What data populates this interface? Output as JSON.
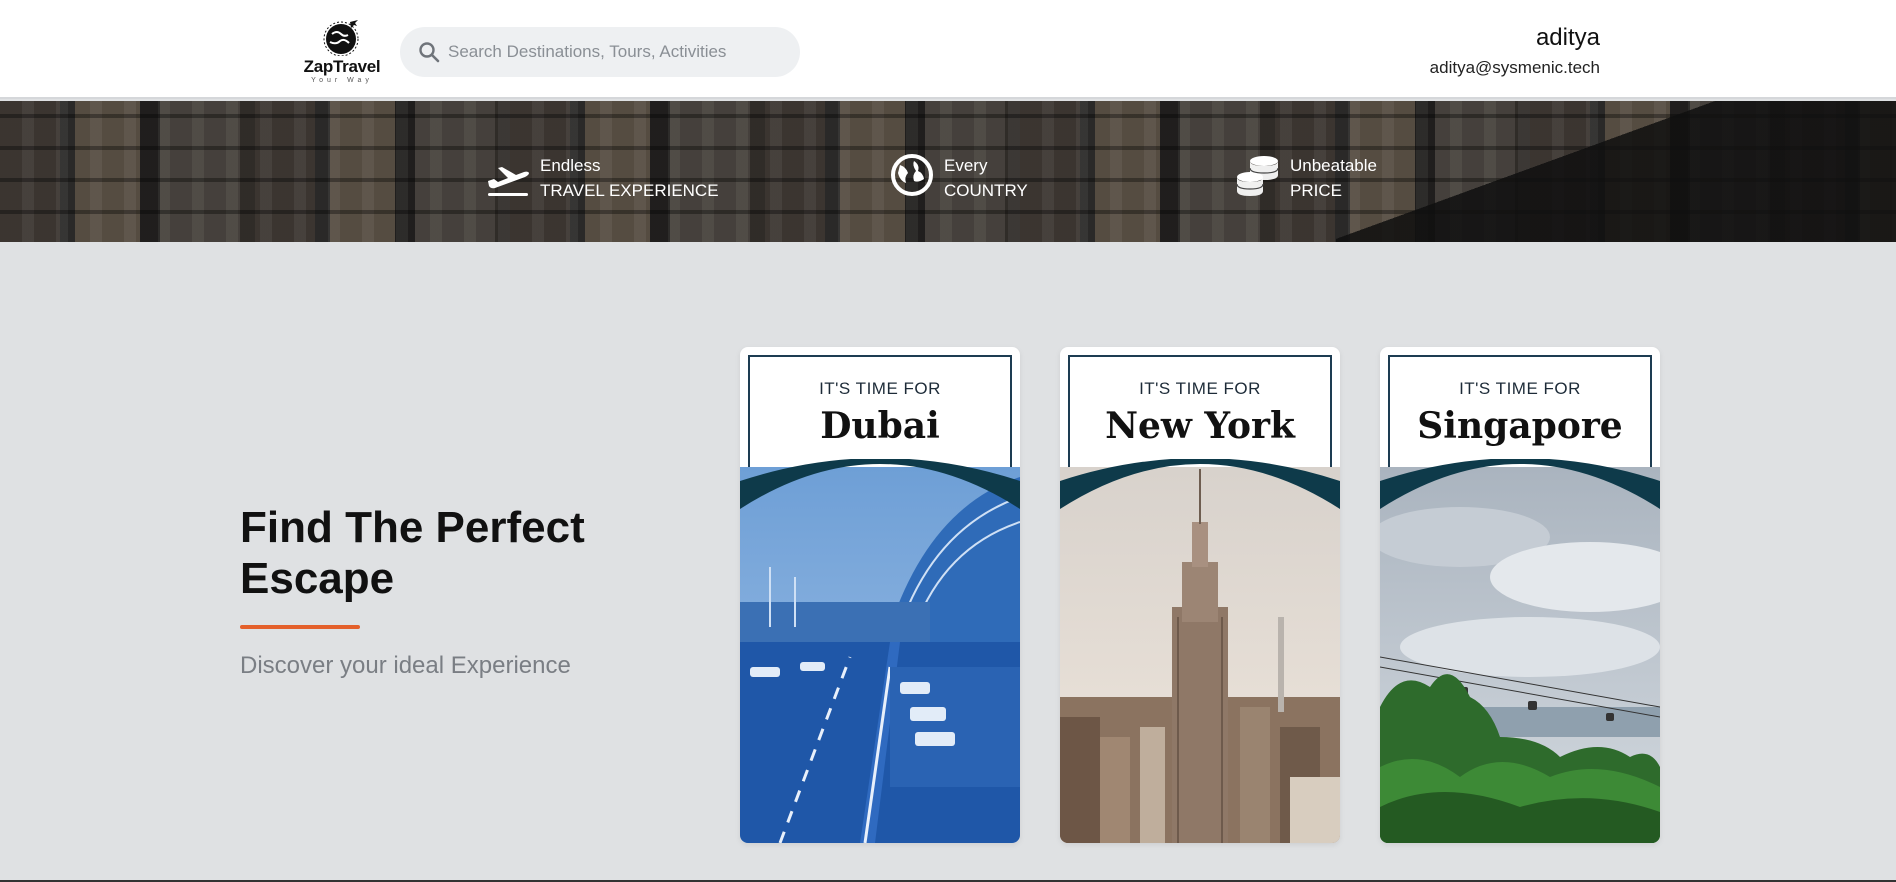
{
  "header": {
    "logo": {
      "brand": "ZapTravel",
      "tagline": "Your Way",
      "icon": "globe-plane-icon"
    },
    "search": {
      "placeholder": "Search Destinations, Tours, Activities",
      "value": "",
      "icon": "search-icon"
    },
    "user": {
      "name": "aditya",
      "email": "aditya@sysmenic.tech"
    }
  },
  "banner": {
    "features": [
      {
        "icon": "airplane-takeoff-icon",
        "line1": "Endless",
        "line2": "TRAVEL EXPERIENCE"
      },
      {
        "icon": "globe-icon",
        "line1": "Every",
        "line2": "COUNTRY"
      },
      {
        "icon": "coins-icon",
        "line1": "Unbeatable",
        "line2": "PRICE"
      }
    ]
  },
  "hero": {
    "title": "Find The Perfect Escape",
    "subtitle": "Discover your ideal Experience",
    "accent_color": "#e4602b"
  },
  "cards": [
    {
      "kicker": "IT'S TIME FOR",
      "destination": "Dubai"
    },
    {
      "kicker": "IT'S TIME FOR",
      "destination": "New York"
    },
    {
      "kicker": "IT'S TIME FOR",
      "destination": "Singapore"
    }
  ],
  "colors": {
    "card_arch": "#0e3a4a",
    "card_frame": "#1d3c52",
    "page_bg": "#dfe1e3"
  }
}
